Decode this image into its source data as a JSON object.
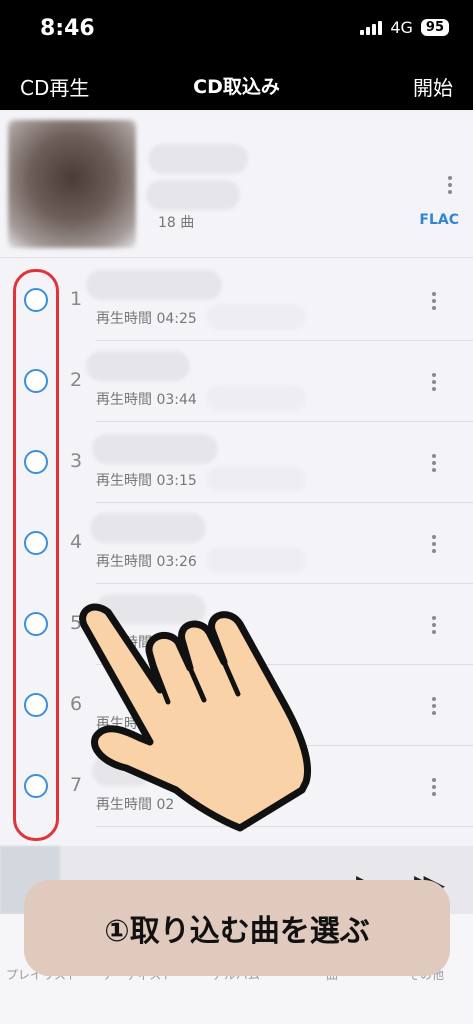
{
  "status": {
    "time": "8:46",
    "network": "4G",
    "battery": "95"
  },
  "nav": {
    "left": "CD再生",
    "title": "CD取込み",
    "right": "開始"
  },
  "album": {
    "track_count": "18 曲",
    "format": "FLAC"
  },
  "tracks": [
    {
      "number": "1",
      "duration": "再生時間 04:25"
    },
    {
      "number": "2",
      "duration": "再生時間 03:44"
    },
    {
      "number": "3",
      "duration": "再生時間 03:15"
    },
    {
      "number": "4",
      "duration": "再生時間 03:26"
    },
    {
      "number": "5",
      "duration": "再生時間"
    },
    {
      "number": "6",
      "duration": "再生時間"
    },
    {
      "number": "7",
      "duration": "再生時間 02"
    }
  ],
  "player": {
    "play_icon": "play-icon",
    "next_icon": "fast-forward-icon"
  },
  "tabs": [
    {
      "label": "プレイリスト",
      "icon": "playlist-icon"
    },
    {
      "label": "アーティスト",
      "icon": "artist-icon"
    },
    {
      "label": "アルバム",
      "icon": "album-icon"
    },
    {
      "label": "曲",
      "icon": "song-icon"
    },
    {
      "label": "その他",
      "icon": "more-icon"
    }
  ],
  "caption": "①取り込む曲を選ぶ",
  "colors": {
    "accent": "#3a8fdc",
    "highlight": "#e0333a",
    "caption_bg": "#e0c9bd"
  }
}
